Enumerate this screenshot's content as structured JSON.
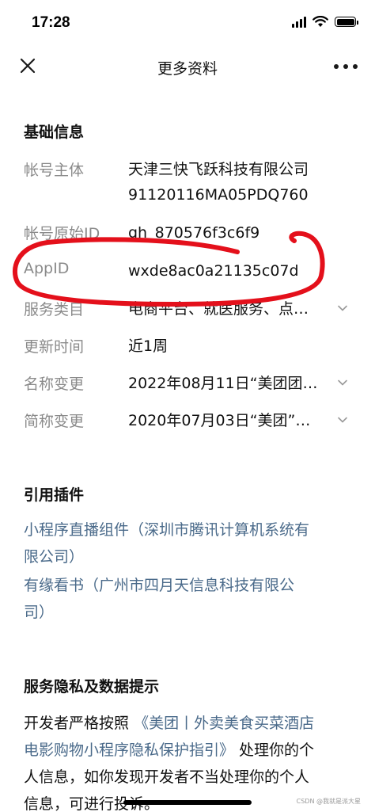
{
  "status_bar": {
    "time": "17:28",
    "icons": [
      "signal-icon",
      "wifi-icon",
      "battery-icon"
    ]
  },
  "nav": {
    "title": "更多资料",
    "close_icon": "close-icon",
    "more_icon": "more-icon"
  },
  "basic_info": {
    "title": "基础信息",
    "rows": [
      {
        "label": "帐号主体",
        "value_lines": [
          "天津三快飞跃科技有限公司",
          "91120116MA05PDQ760"
        ]
      },
      {
        "label": "帐号原始ID",
        "value": "gh_870576f3c6f9"
      },
      {
        "label": "AppID",
        "value": "wxde8ac0a21135c07d"
      },
      {
        "label": "服务类目",
        "value": "电商平台、就医服务、点…"
      },
      {
        "label": "更新时间",
        "value": "近1周"
      },
      {
        "label": "名称变更",
        "value": "2022年08月11日“美团团…"
      },
      {
        "label": "简称变更",
        "value": "2020年07月03日“美团”…"
      }
    ]
  },
  "plugins": {
    "title": "引用插件",
    "items": [
      {
        "lines": [
          "小程序直播组件（深圳市腾讯计算机系统有",
          "限公司）"
        ]
      },
      {
        "lines": [
          "有缘看书（广州市四月天信息科技有限公",
          "司）"
        ]
      }
    ]
  },
  "privacy": {
    "title": "服务隐私及数据提示",
    "prefix": "开发者严格按照",
    "link_line1": "《美团丨外卖美食买菜酒店",
    "link_line2": "电影购物小程序隐私保护指引》",
    "suffix_line2": " 处理你的个",
    "line3": "人信息，如你发现开发者不当处理你的个人",
    "line4": "信息，可进行投诉。"
  },
  "watermark": "CSDN @我就是派大星",
  "colors": {
    "label_gray": "#8a8a8a",
    "link_blue": "#4a6a8a",
    "annotation_red": "#e4101b"
  }
}
